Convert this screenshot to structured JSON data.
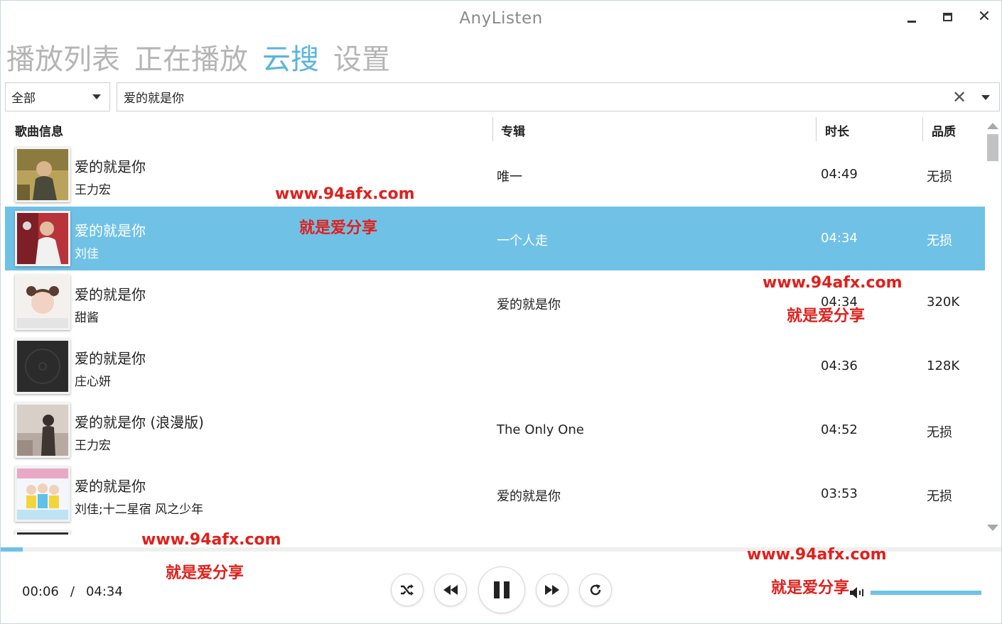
{
  "window": {
    "title": "AnyListen"
  },
  "nav": {
    "tabs": [
      {
        "label": "播放列表",
        "active": false
      },
      {
        "label": "正在播放",
        "active": false
      },
      {
        "label": "云搜",
        "active": true
      },
      {
        "label": "设置",
        "active": false
      }
    ]
  },
  "search": {
    "source": "全部",
    "query": "爱的就是你"
  },
  "table": {
    "columns": {
      "info": "歌曲信息",
      "album": "专辑",
      "duration": "时长",
      "quality": "品质"
    },
    "rows": [
      {
        "title": "爱的就是你",
        "artist": "王力宏",
        "album": "唯一",
        "duration": "04:49",
        "quality": "无损",
        "selected": false
      },
      {
        "title": "爱的就是你",
        "artist": "刘佳",
        "album": "一个人走",
        "duration": "04:34",
        "quality": "无损",
        "selected": true
      },
      {
        "title": "爱的就是你",
        "artist": "甜酱",
        "album": "爱的就是你",
        "duration": "04:34",
        "quality": "320K",
        "selected": false
      },
      {
        "title": "爱的就是你",
        "artist": "庄心妍",
        "album": "",
        "duration": "04:36",
        "quality": "128K",
        "selected": false
      },
      {
        "title": "爱的就是你 (浪漫版)",
        "artist": "王力宏",
        "album": "The Only One",
        "duration": "04:52",
        "quality": "无损",
        "selected": false
      },
      {
        "title": "爱的就是你",
        "artist": "刘佳;十二星宿 风之少年",
        "album": "爱的就是你",
        "duration": "03:53",
        "quality": "无损",
        "selected": false
      }
    ]
  },
  "player": {
    "elapsed": "00:06",
    "separator": "/",
    "total": "04:34",
    "progress": 0.022,
    "volume": 1.0
  },
  "watermarks": [
    {
      "url": "www.94afx.com",
      "slogan": "就是爱分享"
    },
    {
      "url": "www.94afx.com",
      "slogan": "就是爱分享"
    },
    {
      "url": "www.94afx.com",
      "slogan": "就是爱分享"
    },
    {
      "url": "www.94afx.com",
      "slogan": "就是爱分享"
    }
  ],
  "colors": {
    "accent": "#70c1e6",
    "active_tab": "#5bb4de",
    "inactive_tab": "#b5b5b5",
    "watermark": "#e0201c"
  }
}
